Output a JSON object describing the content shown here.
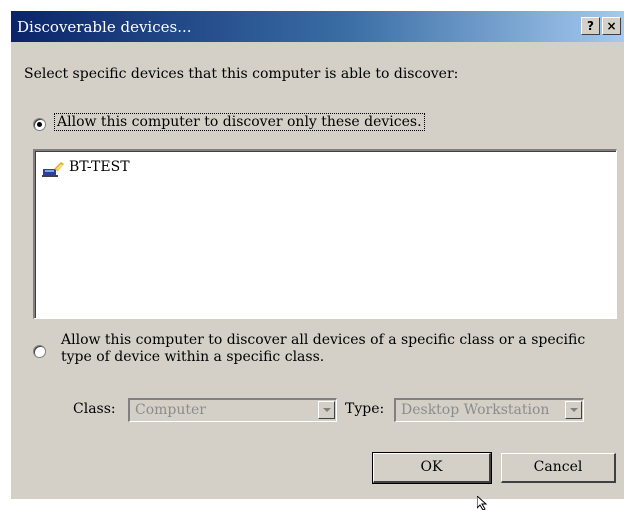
{
  "window": {
    "title": "Discoverable devices...",
    "help_glyph": "?",
    "close_glyph": "×"
  },
  "instruction": "Select specific devices that this computer is able to discover:",
  "option_only": {
    "label": "Allow this computer to discover only these devices.",
    "selected": true
  },
  "device_list": {
    "items": [
      {
        "label": "BT-TEST",
        "icon": "device-icon"
      }
    ]
  },
  "option_class": {
    "line1": "Allow this computer to discover all devices of a specific class or a specific",
    "line2": "type of device within a specific class.",
    "selected": false
  },
  "class_field": {
    "label": "Class:",
    "value": "Computer",
    "enabled": false
  },
  "type_field": {
    "label": "Type:",
    "value": "Desktop Workstation",
    "enabled": false
  },
  "buttons": {
    "ok": "OK",
    "cancel": "Cancel"
  }
}
